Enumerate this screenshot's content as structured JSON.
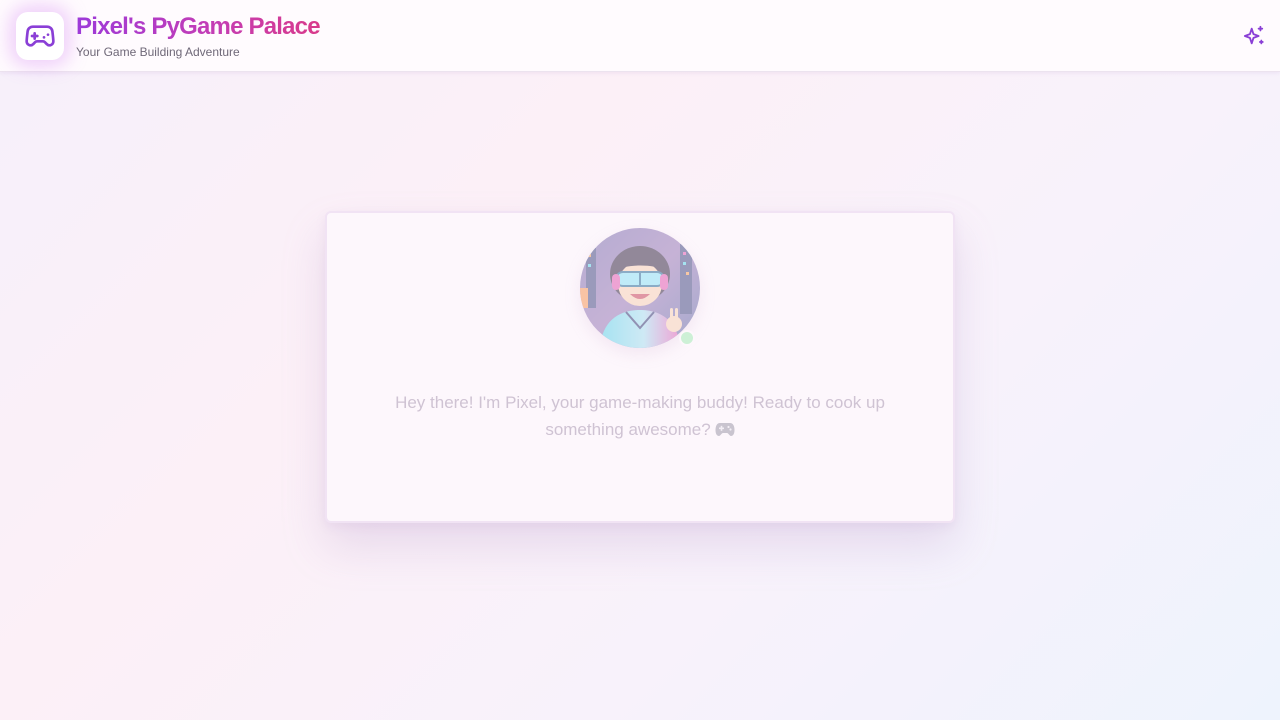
{
  "header": {
    "title": "Pixel's PyGame Palace",
    "subtitle": "Your Game Building Adventure",
    "logo_icon": "gamepad-icon",
    "action_icon": "sparkles-icon"
  },
  "chat": {
    "avatar_icon": "pixel-avatar",
    "status": "online",
    "greeting": "Hey there! I'm Pixel, your game-making buddy! Ready to cook up something awesome?",
    "greeting_emoji_icon": "gamepad-emoji-icon"
  },
  "colors": {
    "accent_purple": "#9d3ad9",
    "accent_pink": "#d93a8a",
    "icon_purple": "#8a3fd6",
    "status_green": "#cdf0d6",
    "greeting_text": "#cfc3d3",
    "subtitle_text": "#6f6878"
  }
}
